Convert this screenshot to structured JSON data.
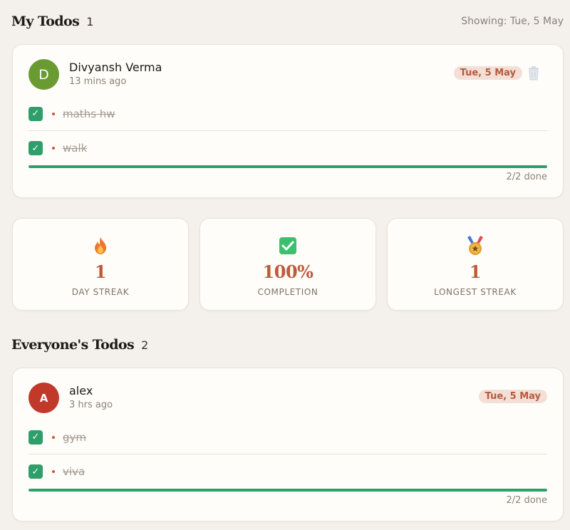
{
  "my_todos": {
    "title": "My Todos",
    "count": "1",
    "showing": "Showing: Tue, 5 May",
    "card": {
      "avatar_letter": "D",
      "avatar_color": "#6a9a32",
      "name": "Divyansh Verma",
      "time": "13 mins ago",
      "date_badge": "Tue, 5 May",
      "items": [
        "maths hw",
        "walk"
      ],
      "progress": 1.0,
      "done_text": "2/2 done"
    }
  },
  "stats": [
    {
      "icon": "fire-icon",
      "value": "1",
      "label": "DAY STREAK"
    },
    {
      "icon": "check-box-icon",
      "value": "100%",
      "label": "COMPLETION"
    },
    {
      "icon": "medal-icon",
      "value": "1",
      "label": "LONGEST STREAK"
    }
  ],
  "everyone": {
    "title": "Everyone's Todos",
    "count": "2",
    "card": {
      "avatar_letter": "A",
      "avatar_color": "#c0392b",
      "name": "alex",
      "time": "3 hrs ago",
      "date_badge": "Tue, 5 May",
      "items": [
        "gym",
        "viva"
      ],
      "progress": 1.0,
      "done_text": "2/2 done"
    }
  },
  "colors": {
    "accent": "#c0583a",
    "success": "#2e9e6a",
    "background": "#f4f1ec"
  }
}
